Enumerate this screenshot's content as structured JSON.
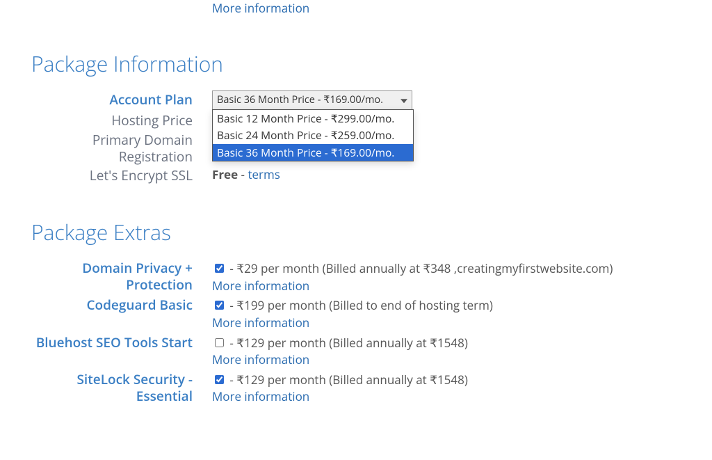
{
  "top": {
    "more_info": "More information"
  },
  "pkg_info": {
    "heading": "Package Information",
    "rows": {
      "account_plan": {
        "label": "Account Plan"
      },
      "hosting_price": {
        "label": "Hosting Price"
      },
      "primary_domain": {
        "label": "Primary Domain Registration"
      },
      "ssl": {
        "label": "Let's Encrypt SSL",
        "value_bold": "Free",
        "sep": " - ",
        "terms": "terms"
      }
    },
    "select": {
      "current": "Basic 36 Month Price - ₹169.00/mo.",
      "options": [
        "Basic 12 Month Price - ₹299.00/mo.",
        "Basic 24 Month Price - ₹259.00/mo.",
        "Basic 36 Month Price - ₹169.00/mo."
      ],
      "selected_index": 2
    }
  },
  "pkg_extras": {
    "heading": "Package Extras",
    "items": [
      {
        "label": "Domain Privacy + Protection",
        "checked": true,
        "desc": " - ₹29 per month (Billed annually at ₹348 ,creatingmyfirstwebsite.com)",
        "more": "More information"
      },
      {
        "label": "Codeguard Basic",
        "checked": true,
        "desc": " - ₹199 per month (Billed to end of hosting term)",
        "more": "More information"
      },
      {
        "label": "Bluehost SEO Tools Start",
        "checked": false,
        "desc": " - ₹129 per month (Billed annually at ₹1548)",
        "more": "More information"
      },
      {
        "label": "SiteLock Security - Essential",
        "checked": true,
        "desc": " - ₹129 per month (Billed annually at ₹1548)",
        "more": "More information"
      }
    ]
  }
}
